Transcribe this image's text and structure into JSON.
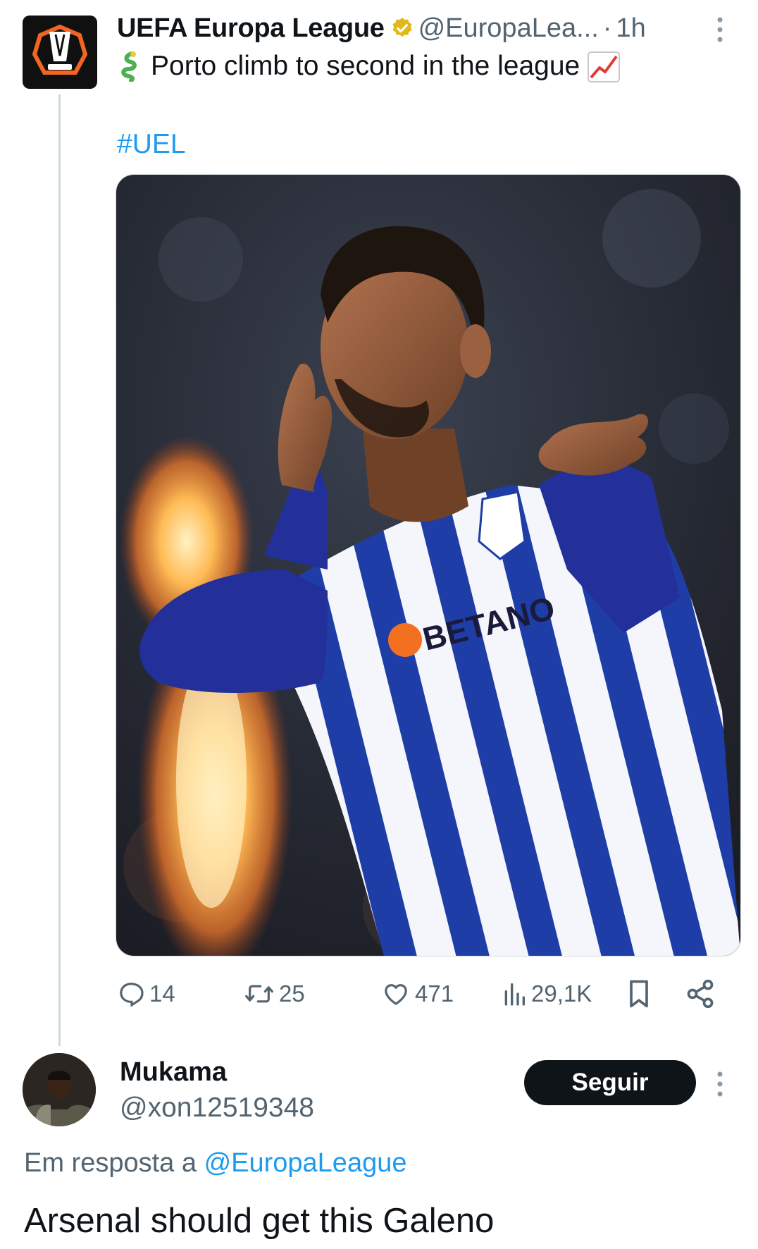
{
  "post": {
    "author_name": "UEFA Europa League",
    "author_handle": "@EuropaLea...",
    "separator": "·",
    "time_ago": "1h",
    "text": "Porto climb to second in the league",
    "hashtag": "#UEL",
    "image_text": "BETANO",
    "metrics": {
      "replies": "14",
      "reposts": "25",
      "likes": "471",
      "views": "29,1K"
    },
    "icons": [
      "more-dots-icon",
      "verified-badge-icon",
      "dragon-emoji",
      "chart-increasing-emoji",
      "reply-icon",
      "repost-icon",
      "like-icon",
      "views-icon",
      "bookmark-icon",
      "share-icon"
    ]
  },
  "reply": {
    "author_name": "Mukama",
    "author_handle": "@xon12519348",
    "follow_label": "Seguir",
    "reply_prefix": "Em resposta a",
    "reply_mention": "@EuropaLeague",
    "text": "Arsenal should get this Galeno"
  },
  "colors": {
    "link": "#1d9bf0",
    "secondary_text": "#536471",
    "verified_gold": "#e2b719",
    "button_bg": "#0f1419",
    "logo_orange": "#f26522"
  }
}
